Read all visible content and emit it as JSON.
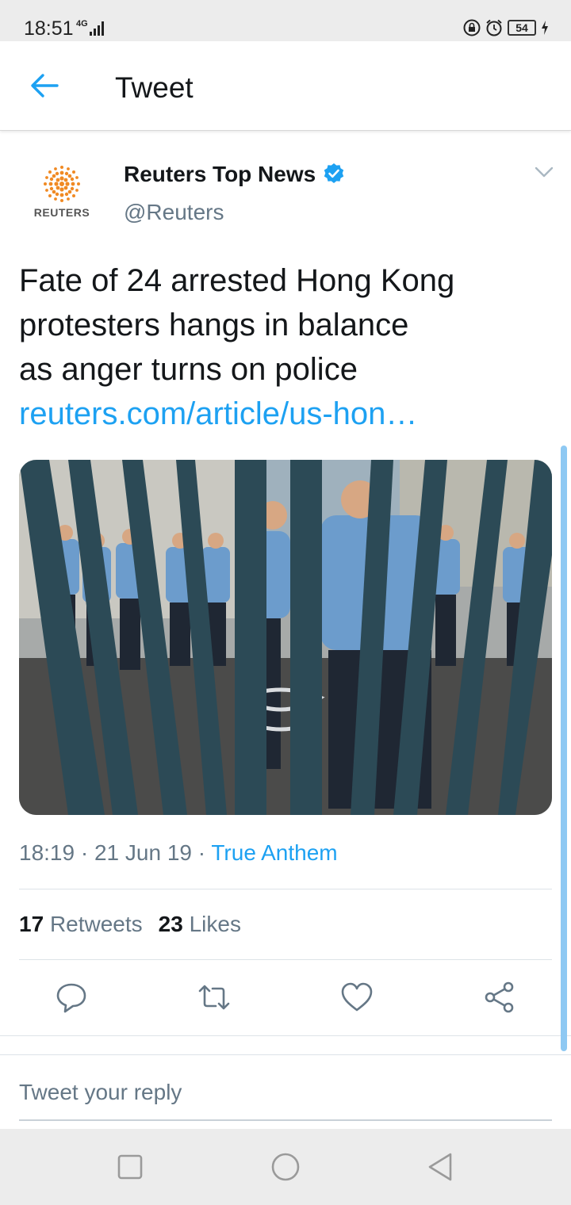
{
  "status_bar": {
    "time": "18:51",
    "network": "4G",
    "battery": "54"
  },
  "header": {
    "title": "Tweet"
  },
  "tweet": {
    "avatar_text": "REUTERS",
    "author_name": "Reuters Top News",
    "author_handle": "@Reuters",
    "text_lines": [
      "Fate of 24 arrested Hong Kong",
      "protesters hangs in balance",
      "as anger turns on police"
    ],
    "link": "reuters.com/article/us-hon…",
    "time": "18:19",
    "date": "21 Jun 19",
    "app": "True Anthem",
    "retweet_count": "17",
    "retweet_label": "Retweets",
    "like_count": "23",
    "like_label": "Likes"
  },
  "actions": [
    "reply-icon",
    "retweet-icon",
    "like-icon",
    "share-icon"
  ],
  "reply": {
    "placeholder": "Tweet your reply"
  },
  "colors": {
    "accent": "#1da1f2",
    "secondary_text": "#657786",
    "brand_orange": "#f08a24"
  }
}
